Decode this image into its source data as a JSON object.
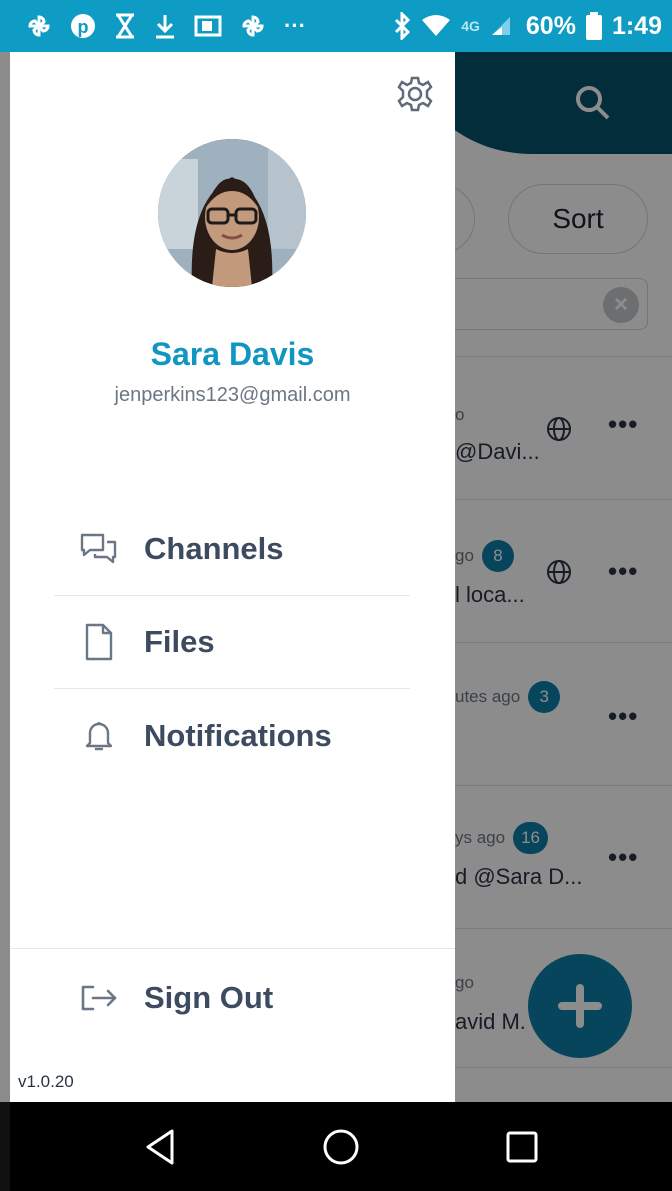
{
  "status_bar": {
    "battery": "60%",
    "time": "1:49",
    "network": "4G",
    "icons": [
      "pinwheel-icon",
      "pinterest-icon",
      "hourglass-icon",
      "download-icon",
      "reader-icon",
      "pinwheel-icon",
      "more-icon",
      "bluetooth-icon",
      "wifi-icon",
      "signal-icon",
      "battery-icon"
    ]
  },
  "background_app": {
    "sort_label": "Sort",
    "rows": [
      {
        "meta": "o",
        "snippet": "@Davi...",
        "badge": "",
        "globe": true
      },
      {
        "meta": "go",
        "snippet": "l loca...",
        "badge": "8",
        "globe": true
      },
      {
        "meta": "utes ago",
        "snippet": "",
        "badge": "3",
        "globe": false
      },
      {
        "meta": "ys ago",
        "snippet": "d @Sara D...",
        "badge": "16",
        "globe": false
      },
      {
        "meta": "go",
        "snippet": "avid M.",
        "badge": "",
        "globe": false
      }
    ]
  },
  "drawer": {
    "user": {
      "name": "Sara Davis",
      "email": "jenperkins123@gmail.com"
    },
    "menu": [
      {
        "label": "Channels",
        "icon": "chat-bubbles-icon"
      },
      {
        "label": "Files",
        "icon": "file-icon"
      },
      {
        "label": "Notifications",
        "icon": "bell-icon"
      }
    ],
    "sign_out_label": "Sign Out",
    "version": "v1.0.20"
  },
  "colors": {
    "accent": "#1196c2",
    "status_bar": "#0e9bc4",
    "header": "#06526b",
    "badge": "#0e7ea8",
    "menu_text": "#3d4b60"
  }
}
